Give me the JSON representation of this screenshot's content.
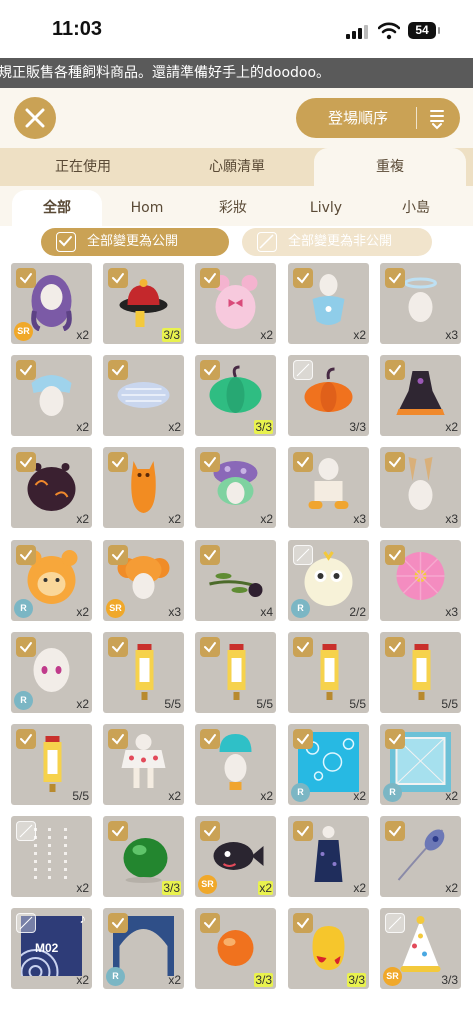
{
  "status_bar": {
    "time": "11:03",
    "battery": "54"
  },
  "marquee": "規正販售各種飼料商品。還請準備好手上的doodoo。",
  "header": {
    "sort_label": "登場順序"
  },
  "tabs": [
    {
      "label": "正在使用",
      "active": false
    },
    {
      "label": "心願清單",
      "active": false
    },
    {
      "label": "重複",
      "active": true
    }
  ],
  "subtabs": [
    {
      "label": "全部",
      "active": true
    },
    {
      "label": "Hom",
      "active": false
    },
    {
      "label": "彩妝",
      "active": false
    },
    {
      "label": "Livly",
      "active": false
    },
    {
      "label": "小島",
      "active": false
    }
  ],
  "bulk": {
    "public_label": "全部變更為公開",
    "private_label": "全部變更為非公開"
  },
  "colors": {
    "gold": "#caa255",
    "cell_bg": "#c8c3bc",
    "tab_bar": "#eee0c4",
    "highlight": "#e9f24e"
  },
  "items": [
    {
      "icon": "purple-hair-icon",
      "checked": true,
      "count": "x2",
      "rarity": "SR",
      "hl": false
    },
    {
      "icon": "red-hat-icon",
      "checked": true,
      "count": "3/3",
      "rarity": "",
      "hl": true
    },
    {
      "icon": "pink-bear-hat-icon",
      "checked": true,
      "count": "x2",
      "rarity": "",
      "hl": false
    },
    {
      "icon": "blue-bib-icon",
      "checked": true,
      "count": "x2",
      "rarity": "",
      "hl": false
    },
    {
      "icon": "halo-icon",
      "checked": true,
      "count": "x3",
      "rarity": "",
      "hl": false
    },
    {
      "icon": "blue-bonnet-icon",
      "checked": true,
      "count": "x2",
      "rarity": "",
      "hl": false
    },
    {
      "icon": "cushion-icon",
      "checked": true,
      "count": "x2",
      "rarity": "",
      "hl": false
    },
    {
      "icon": "green-pumpkin-icon",
      "checked": true,
      "count": "3/3",
      "rarity": "",
      "hl": true
    },
    {
      "icon": "orange-pumpkin-icon",
      "checked": false,
      "count": "3/3",
      "rarity": "",
      "hl": false
    },
    {
      "icon": "halloween-dress-icon",
      "checked": true,
      "count": "x2",
      "rarity": "",
      "hl": false
    },
    {
      "icon": "dark-pot-icon",
      "checked": true,
      "count": "x2",
      "rarity": "",
      "hl": false
    },
    {
      "icon": "orange-costume-icon",
      "checked": true,
      "count": "x2",
      "rarity": "",
      "hl": false
    },
    {
      "icon": "mushroom-hair-icon",
      "checked": true,
      "count": "x2",
      "rarity": "",
      "hl": false
    },
    {
      "icon": "white-gloves-icon",
      "checked": true,
      "count": "x3",
      "rarity": "",
      "hl": false
    },
    {
      "icon": "bunny-ears-icon",
      "checked": true,
      "count": "x3",
      "rarity": "",
      "hl": false
    },
    {
      "icon": "lion-mask-icon",
      "checked": true,
      "count": "x2",
      "rarity": "R",
      "hl": false
    },
    {
      "icon": "orange-bun-hair-icon",
      "checked": true,
      "count": "x3",
      "rarity": "SR",
      "hl": false
    },
    {
      "icon": "olive-branch-icon",
      "checked": true,
      "count": "x4",
      "rarity": "",
      "hl": false
    },
    {
      "icon": "fluffy-chick-icon",
      "checked": false,
      "count": "2/2",
      "rarity": "R",
      "hl": false
    },
    {
      "icon": "cosmos-flower-icon",
      "checked": true,
      "count": "x3",
      "rarity": "",
      "hl": false
    },
    {
      "icon": "face-makeup-icon",
      "checked": true,
      "count": "x2",
      "rarity": "R",
      "hl": false
    },
    {
      "icon": "scroll-banner-icon",
      "checked": true,
      "count": "5/5",
      "rarity": "",
      "hl": false
    },
    {
      "icon": "scroll-banner-icon",
      "checked": true,
      "count": "5/5",
      "rarity": "",
      "hl": false
    },
    {
      "icon": "scroll-banner-icon",
      "checked": true,
      "count": "5/5",
      "rarity": "",
      "hl": false
    },
    {
      "icon": "scroll-banner-icon",
      "checked": true,
      "count": "5/5",
      "rarity": "",
      "hl": false
    },
    {
      "icon": "scroll-banner-icon",
      "checked": true,
      "count": "5/5",
      "rarity": "",
      "hl": false
    },
    {
      "icon": "strawberry-skirt-icon",
      "checked": true,
      "count": "x2",
      "rarity": "",
      "hl": false
    },
    {
      "icon": "jelly-hat-icon",
      "checked": true,
      "count": "x2",
      "rarity": "",
      "hl": false
    },
    {
      "icon": "bubble-background-icon",
      "checked": true,
      "count": "x2",
      "rarity": "R",
      "hl": false
    },
    {
      "icon": "window-background-icon",
      "checked": true,
      "count": "x2",
      "rarity": "R",
      "hl": false
    },
    {
      "icon": "dotted-rain-icon",
      "checked": false,
      "count": "x2",
      "rarity": "",
      "hl": false
    },
    {
      "icon": "green-orb-icon",
      "checked": true,
      "count": "3/3",
      "rarity": "",
      "hl": true
    },
    {
      "icon": "black-fish-icon",
      "checked": true,
      "count": "x2",
      "rarity": "SR",
      "hl": true
    },
    {
      "icon": "navy-dress-icon",
      "checked": true,
      "count": "x2",
      "rarity": "",
      "hl": false
    },
    {
      "icon": "peacock-feather-icon",
      "checked": true,
      "count": "x2",
      "rarity": "",
      "hl": false
    },
    {
      "icon": "music-record-icon",
      "checked": false,
      "count": "x2",
      "rarity": "",
      "hl": false,
      "label": "M02",
      "music": true
    },
    {
      "icon": "arch-background-icon",
      "checked": true,
      "count": "x2",
      "rarity": "R",
      "hl": false
    },
    {
      "icon": "orange-orb-icon",
      "checked": true,
      "count": "3/3",
      "rarity": "",
      "hl": true
    },
    {
      "icon": "yellow-orb-icon",
      "checked": true,
      "count": "3/3",
      "rarity": "",
      "hl": true
    },
    {
      "icon": "party-hat-icon",
      "checked": false,
      "count": "3/3",
      "rarity": "SR",
      "hl": false
    }
  ]
}
